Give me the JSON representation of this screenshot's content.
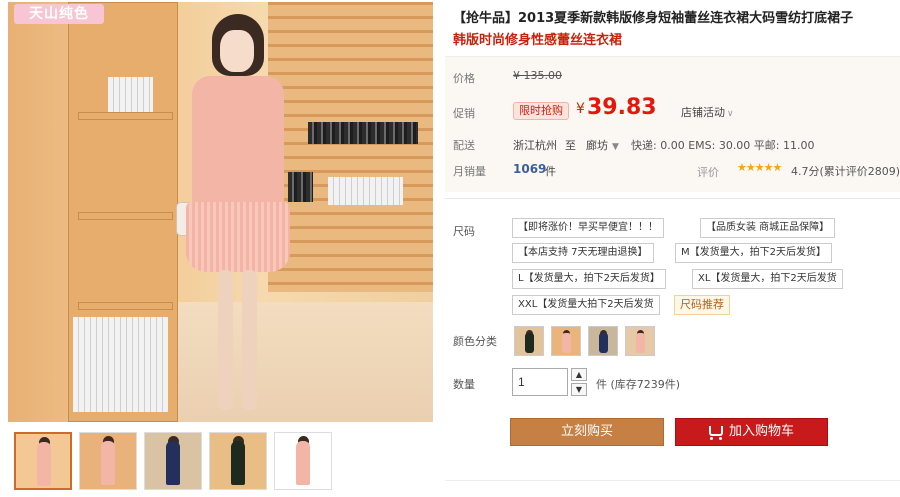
{
  "gallery": {
    "watermark": "天山纯色",
    "thumbnails": [
      {
        "bg": "#f3c894",
        "dress": "#f3b6a6",
        "active": true
      },
      {
        "bg": "#e8b27a",
        "dress": "#f3b6a6",
        "active": false
      },
      {
        "bg": "#d9c3a3",
        "dress": "#24305c",
        "active": false
      },
      {
        "bg": "#e9be86",
        "dress": "#1e2a1e",
        "active": false
      },
      {
        "bg": "#ffffff",
        "dress": "#f3b6a6",
        "active": false
      }
    ]
  },
  "product": {
    "title": "【抢牛品】2013夏季新款韩版修身短袖蕾丝连衣裙大码雪纺打底裙子",
    "subtitle": "韩版时尚修身性感蕾丝连衣裙"
  },
  "pricing": {
    "price_label": "价格",
    "original_price": "¥ 135.00",
    "promo_label": "促销",
    "promo_tag": "限时抢购",
    "currency": "¥",
    "current_price": "39.83",
    "shop_promo": "店铺活动",
    "accent_color": "#e4170a"
  },
  "shipping": {
    "label": "配送",
    "from": "浙江杭州",
    "to_word": "至",
    "destination": "廊坊",
    "fees": "快递: 0.00 EMS: 30.00 平邮: 11.00"
  },
  "sales": {
    "label": "月销量",
    "count": "1069",
    "unit": "件",
    "rating_label": "评价",
    "rating_text": "4.7分(累计评价2809)"
  },
  "options": {
    "size_label": "尺码",
    "sizes": [
      "【即将涨价！早买早便宜！！！",
      "【品质女装 商城正品保障】",
      "【本店支持 7天无理由退换】",
      "M【发货量大，拍下2天后发货】",
      "L【发货量大，拍下2天后发货】",
      "XL【发货量大，拍下2天后发货",
      "XXL【发货量大拍下2天后发货"
    ],
    "size_help": "尺码推荐",
    "color_label": "颜色分类",
    "colors": [
      {
        "bg": "#e2c49c",
        "dress": "#1e2a1e"
      },
      {
        "bg": "#eab57a",
        "dress": "#f3b6a6"
      },
      {
        "bg": "#c9b79b",
        "dress": "#24305c"
      },
      {
        "bg": "#e6c9a6",
        "dress": "#f3b6a6"
      }
    ]
  },
  "quantity": {
    "label": "数量",
    "value": "1",
    "stock_text": "件 (库存7239件)"
  },
  "actions": {
    "buy_now": "立刻购买",
    "add_to_cart": "加入购物车"
  }
}
